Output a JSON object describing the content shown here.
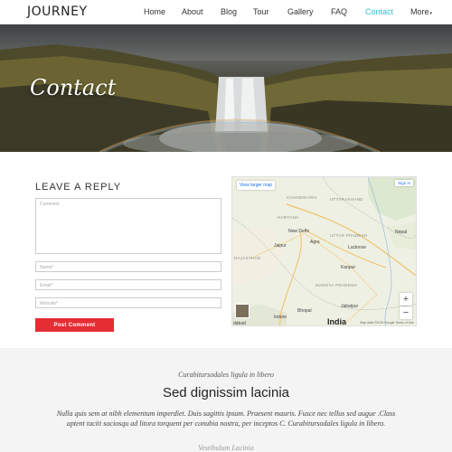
{
  "header": {
    "logo": "JOURNEY",
    "nav": [
      {
        "label": "Home"
      },
      {
        "label": "About"
      },
      {
        "label": "Blog"
      },
      {
        "label": "Tour"
      },
      {
        "label": "Gallery"
      },
      {
        "label": "FAQ"
      },
      {
        "label": "Contact",
        "active": true
      },
      {
        "label": "More"
      }
    ],
    "accent_color": "#2ec4d6"
  },
  "hero": {
    "title": "Contact"
  },
  "form": {
    "title": "LEAVE A REPLY",
    "comment_placeholder": "Comment",
    "name_placeholder": "Name*",
    "email_placeholder": "Email*",
    "website_placeholder": "Website*",
    "submit_label": "Post Comment",
    "submit_color": "#e52d34"
  },
  "map": {
    "view_larger": "View larger map",
    "sign_in": "Sign in",
    "country": "India",
    "zoom_in": "+",
    "zoom_out": "−",
    "attribution": "Map data ©2019 Google   Terms of Use",
    "labels": {
      "chandigarh": "CHANDIGARH",
      "uttarakhand": "UTTARAKHAND",
      "haryana": "HARYANA",
      "new_delhi": "New Delhi",
      "nepal": "Nepal",
      "jaipur": "Jaipur",
      "agra": "Agra",
      "uttar_pradesh": "UTTAR PRADESH",
      "lucknow": "Lucknow",
      "rajasthan": "RAJASTHAN",
      "kanpur": "Kanpur",
      "madhya_pradesh": "MADHYA PRADESH",
      "indore": "Indore",
      "bhopal": "Bhopal",
      "jabalpur": "Jabalpur",
      "dabad": "dabad"
    }
  },
  "section": {
    "subtitle": "Curabitursodales ligula in libero",
    "title": "Sed dignissim lacinia",
    "text": "Nulla quis sem at nibh elementum imperdiet. Duis sagittis ipsum. Praesent mauris. Fusce nec tellus sed augue .Class aptent taciti sociosqu ad litora torquent per conubia nostra, per inceptos C. Curabitursodales ligula in libero.",
    "footer": "Vestibulum Lacinia"
  }
}
